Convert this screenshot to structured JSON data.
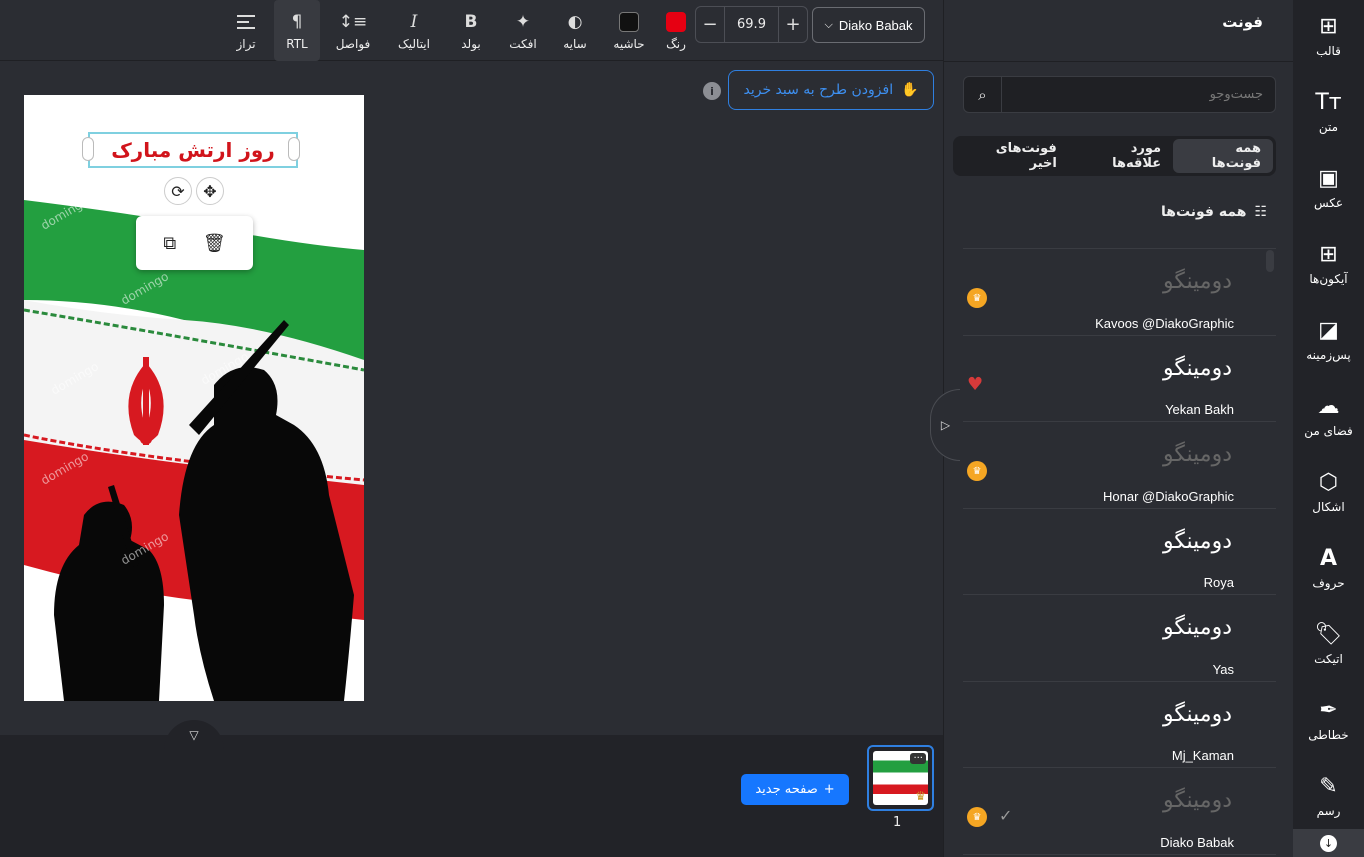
{
  "toolbar": {
    "align_label": "تراز",
    "rtl_label": "RTL",
    "spacing_label": "فواصل",
    "italic_label": "ایتالیک",
    "bold_label": "بولد",
    "effect_label": "افکت",
    "shadow_label": "سایه",
    "border_label": "حاشیه",
    "color_label": "رنگ",
    "font_size": "69.9",
    "font_name": "Diako Babak",
    "text_color": "#e60012",
    "border_color": "#111111"
  },
  "canvas": {
    "add_to_cart_label": "افزودن طرح به سبد خرید",
    "poster_title": "روز ارتش مبارک",
    "watermark": "domingo"
  },
  "pages": {
    "new_page_label": "صفحه جدید",
    "page_number": "1"
  },
  "font_panel": {
    "title": "فونت",
    "search_placeholder": "جست‌وجو",
    "tabs": [
      "همه فونت‌ها",
      "مورد علاقه‌ها",
      "فونت‌های اخیر"
    ],
    "section_title": "همه فونت‌ها",
    "fonts": [
      {
        "preview": "دومینگو",
        "name": "Kavoos @DiakoGraphic",
        "premium": true,
        "favorite": false,
        "selected": false,
        "dim": true
      },
      {
        "preview": "دومینگو",
        "name": "Yekan Bakh",
        "premium": false,
        "favorite": true,
        "selected": false,
        "dim": false
      },
      {
        "preview": "دومینگو",
        "name": "Honar @DiakoGraphic",
        "premium": true,
        "favorite": false,
        "selected": false,
        "dim": true
      },
      {
        "preview": "دومینگو",
        "name": "Roya",
        "premium": false,
        "favorite": false,
        "selected": false,
        "dim": false
      },
      {
        "preview": "دومینگو",
        "name": "Yas",
        "premium": false,
        "favorite": false,
        "selected": false,
        "dim": false
      },
      {
        "preview": "دومینگو",
        "name": "Mj_Kaman",
        "premium": false,
        "favorite": false,
        "selected": false,
        "dim": false
      },
      {
        "preview": "دومینگو",
        "name": "Diako Babak",
        "premium": true,
        "favorite": false,
        "selected": true,
        "dim": true
      }
    ]
  },
  "sidebar": {
    "items": [
      "قالب",
      "متن",
      "عکس",
      "آیکون‌ها",
      "پس‌زمینه",
      "فضای من",
      "اشکال",
      "حروف",
      "اتیکت",
      "خطاطی",
      "رسم"
    ]
  },
  "colors": {
    "accent": "#1677ff",
    "flag_green": "#239f40",
    "flag_red": "#d71920"
  }
}
